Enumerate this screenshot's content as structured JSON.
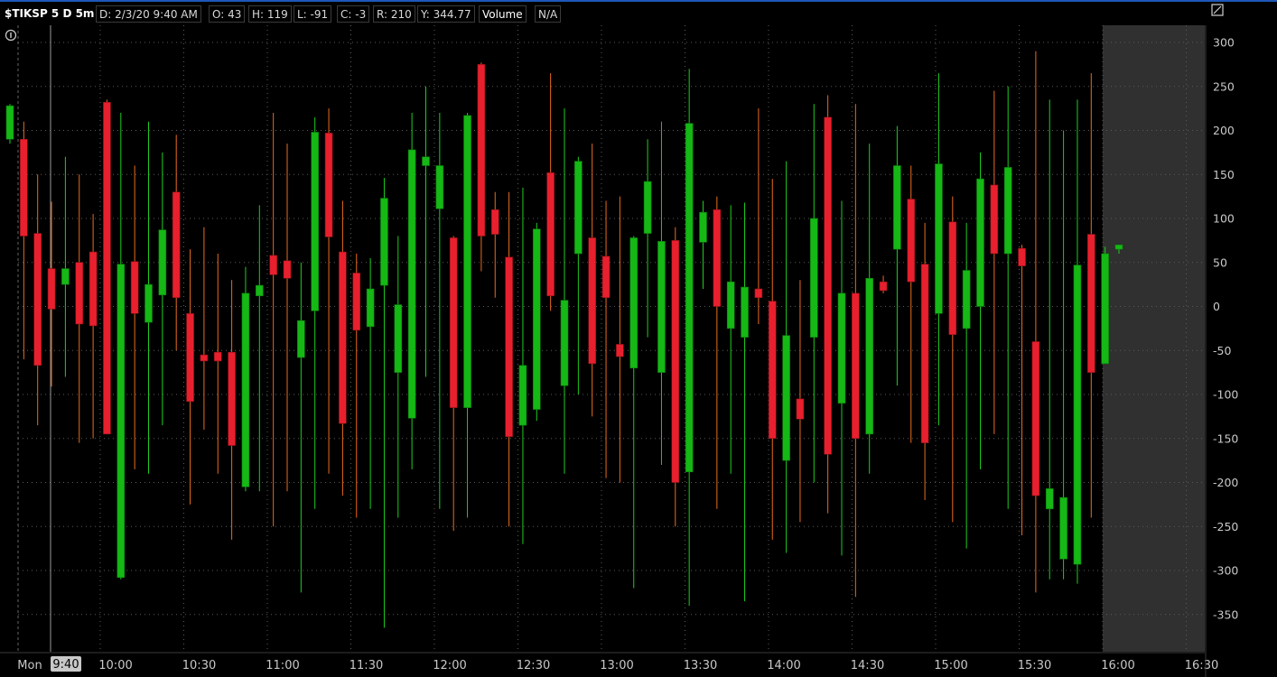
{
  "header": {
    "symbol": "$TIKSP 5 D 5m",
    "date": "D: 2/3/20 9:40 AM",
    "open": "O: 43",
    "high": "H: 119",
    "low": "L: -91",
    "close": "C: -3",
    "range": "R: 210",
    "y_value": "Y: 344.77",
    "volume_label": "Volume",
    "volume_value": "N/A"
  },
  "colors": {
    "up": "#15b815",
    "down": "#e8202e",
    "up_wick": "#1ecc1e",
    "down_wick": "#e86b1e",
    "grid": "#5a5a5a",
    "after_hours": "#303030"
  },
  "cursor_label": "9:40",
  "chart_data": {
    "type": "candlestick",
    "title": "$TIKSP 5 D 5m",
    "ylim": [
      -375,
      300
    ],
    "y_ticks": [
      300,
      250,
      200,
      150,
      100,
      50,
      0,
      -50,
      -100,
      -150,
      -200,
      -250,
      -300,
      -350
    ],
    "x_ticks": [
      "Mon",
      "10:00",
      "10:30",
      "11:00",
      "11:30",
      "12:00",
      "12:30",
      "13:00",
      "13:30",
      "14:00",
      "14:30",
      "15:00",
      "15:30",
      "16:00",
      "16:30"
    ],
    "cursor_time": "9:40",
    "grid": true,
    "after_hours_from": "16:00",
    "candles": [
      {
        "t": "9:30",
        "o": 190,
        "h": 230,
        "l": 185,
        "c": 228
      },
      {
        "t": "9:35",
        "o": 190,
        "h": 210,
        "l": -60,
        "c": 80
      },
      {
        "t": "9:40",
        "o": 83,
        "h": 150,
        "l": -135,
        "c": -67
      },
      {
        "t": "9:45",
        "o": 43,
        "h": 119,
        "l": -91,
        "c": -3
      },
      {
        "t": "9:50",
        "o": 25,
        "h": 170,
        "l": -80,
        "c": 43
      },
      {
        "t": "9:55",
        "o": 50,
        "h": 150,
        "l": -155,
        "c": -20
      },
      {
        "t": "10:00",
        "o": 62,
        "h": 105,
        "l": -150,
        "c": -22
      },
      {
        "t": "10:05",
        "o": 232,
        "h": 235,
        "l": -130,
        "c": -145
      },
      {
        "t": "10:10",
        "o": -308,
        "h": 220,
        "l": -310,
        "c": 48
      },
      {
        "t": "10:15",
        "o": 51,
        "h": 160,
        "l": -185,
        "c": -8
      },
      {
        "t": "10:20",
        "o": -18,
        "h": 210,
        "l": -190,
        "c": 25
      },
      {
        "t": "10:25",
        "o": 13,
        "h": 175,
        "l": -135,
        "c": 87
      },
      {
        "t": "10:30",
        "o": 130,
        "h": 195,
        "l": -50,
        "c": 10
      },
      {
        "t": "10:35",
        "o": -8,
        "h": 65,
        "l": -225,
        "c": -108
      },
      {
        "t": "10:40",
        "o": -55,
        "h": 90,
        "l": -140,
        "c": -62
      },
      {
        "t": "10:45",
        "o": -52,
        "h": 60,
        "l": -190,
        "c": -62
      },
      {
        "t": "10:50",
        "o": -52,
        "h": 30,
        "l": -265,
        "c": -158
      },
      {
        "t": "10:55",
        "o": -205,
        "h": 45,
        "l": -210,
        "c": 15
      },
      {
        "t": "11:00",
        "o": 12,
        "h": 115,
        "l": -210,
        "c": 24
      },
      {
        "t": "11:05",
        "o": 58,
        "h": 220,
        "l": -250,
        "c": 36
      },
      {
        "t": "11:10",
        "o": 52,
        "h": 185,
        "l": -210,
        "c": 32
      },
      {
        "t": "11:15",
        "o": -58,
        "h": 50,
        "l": -325,
        "c": -16
      },
      {
        "t": "11:20",
        "o": -5,
        "h": 215,
        "l": -230,
        "c": 198
      },
      {
        "t": "11:25",
        "o": 197,
        "h": 225,
        "l": -190,
        "c": 79
      },
      {
        "t": "11:30",
        "o": 62,
        "h": 120,
        "l": -215,
        "c": -133
      },
      {
        "t": "11:35",
        "o": 38,
        "h": 60,
        "l": -240,
        "c": -27
      },
      {
        "t": "11:40",
        "o": -23,
        "h": 55,
        "l": -230,
        "c": 20
      },
      {
        "t": "11:45",
        "o": 24,
        "h": 146,
        "l": -365,
        "c": 123
      },
      {
        "t": "11:50",
        "o": -75,
        "h": 80,
        "l": -240,
        "c": 2
      },
      {
        "t": "11:55",
        "o": -127,
        "h": 220,
        "l": -185,
        "c": 178
      },
      {
        "t": "12:00",
        "o": 160,
        "h": 250,
        "l": -80,
        "c": 170
      },
      {
        "t": "12:05",
        "o": 111,
        "h": 220,
        "l": -230,
        "c": 160
      },
      {
        "t": "12:10",
        "o": 78,
        "h": 80,
        "l": -255,
        "c": -115
      },
      {
        "t": "12:15",
        "o": -115,
        "h": 220,
        "l": -240,
        "c": 217
      },
      {
        "t": "12:20",
        "o": 275,
        "h": 277,
        "l": 40,
        "c": 80
      },
      {
        "t": "12:25",
        "o": 110,
        "h": 130,
        "l": 10,
        "c": 82
      },
      {
        "t": "12:30",
        "o": 56,
        "h": 130,
        "l": -250,
        "c": -148
      },
      {
        "t": "12:35",
        "o": -135,
        "h": 135,
        "l": -270,
        "c": -67
      },
      {
        "t": "12:40",
        "o": -117,
        "h": 95,
        "l": -130,
        "c": 88
      },
      {
        "t": "12:45",
        "o": 152,
        "h": 265,
        "l": -5,
        "c": 12
      },
      {
        "t": "12:50",
        "o": -90,
        "h": 225,
        "l": -190,
        "c": 7
      },
      {
        "t": "12:55",
        "o": 60,
        "h": 170,
        "l": -100,
        "c": 165
      },
      {
        "t": "13:00",
        "o": 78,
        "h": 185,
        "l": -125,
        "c": -65
      },
      {
        "t": "13:05",
        "o": 57,
        "h": 120,
        "l": -195,
        "c": 10
      },
      {
        "t": "13:10",
        "o": -43,
        "h": 125,
        "l": -200,
        "c": -57
      },
      {
        "t": "13:15",
        "o": -70,
        "h": 80,
        "l": -320,
        "c": 78
      },
      {
        "t": "13:20",
        "o": 83,
        "h": 190,
        "l": -35,
        "c": 142
      },
      {
        "t": "13:25",
        "o": -75,
        "h": 210,
        "l": -180,
        "c": 74
      },
      {
        "t": "13:30",
        "o": 75,
        "h": 90,
        "l": -250,
        "c": -200
      },
      {
        "t": "13:35",
        "o": -188,
        "h": 270,
        "l": -340,
        "c": 208
      },
      {
        "t": "13:40",
        "o": 73,
        "h": 120,
        "l": 20,
        "c": 107
      },
      {
        "t": "13:45",
        "o": 110,
        "h": 125,
        "l": -230,
        "c": 0
      },
      {
        "t": "13:50",
        "o": -25,
        "h": 115,
        "l": -190,
        "c": 28
      },
      {
        "t": "13:55",
        "o": -35,
        "h": 118,
        "l": -335,
        "c": 22
      },
      {
        "t": "14:00",
        "o": 20,
        "h": 225,
        "l": -20,
        "c": 10
      },
      {
        "t": "14:05",
        "o": 6,
        "h": 145,
        "l": -265,
        "c": -150
      },
      {
        "t": "14:10",
        "o": -175,
        "h": 165,
        "l": -280,
        "c": -33
      },
      {
        "t": "14:15",
        "o": -105,
        "h": 30,
        "l": -245,
        "c": -128
      },
      {
        "t": "14:20",
        "o": -35,
        "h": 230,
        "l": -200,
        "c": 100
      },
      {
        "t": "14:25",
        "o": 215,
        "h": 240,
        "l": -235,
        "c": -168
      },
      {
        "t": "14:30",
        "o": -110,
        "h": 120,
        "l": -283,
        "c": 15
      },
      {
        "t": "14:35",
        "o": 15,
        "h": 230,
        "l": -330,
        "c": -150
      },
      {
        "t": "14:40",
        "o": -145,
        "h": 185,
        "l": -190,
        "c": 32
      },
      {
        "t": "14:45",
        "o": 28,
        "h": 35,
        "l": 15,
        "c": 18
      },
      {
        "t": "14:50",
        "o": 65,
        "h": 205,
        "l": -90,
        "c": 160
      },
      {
        "t": "14:55",
        "o": 122,
        "h": 160,
        "l": -155,
        "c": 28
      },
      {
        "t": "15:00",
        "o": 48,
        "h": 95,
        "l": -220,
        "c": -155
      },
      {
        "t": "15:05",
        "o": -8,
        "h": 265,
        "l": -135,
        "c": 162
      },
      {
        "t": "15:10",
        "o": 96,
        "h": 125,
        "l": -245,
        "c": -32
      },
      {
        "t": "15:15",
        "o": -25,
        "h": 95,
        "l": -275,
        "c": 41
      },
      {
        "t": "15:20",
        "o": 0,
        "h": 175,
        "l": -185,
        "c": 145
      },
      {
        "t": "15:25",
        "o": 138,
        "h": 245,
        "l": -145,
        "c": 60
      },
      {
        "t": "15:30",
        "o": 60,
        "h": 250,
        "l": -230,
        "c": 158
      },
      {
        "t": "15:35",
        "o": 66,
        "h": 70,
        "l": -260,
        "c": 46
      },
      {
        "t": "15:40",
        "o": -40,
        "h": 290,
        "l": -325,
        "c": -215
      },
      {
        "t": "15:45",
        "o": -230,
        "h": 235,
        "l": -310,
        "c": -207
      },
      {
        "t": "15:50",
        "o": -287,
        "h": 200,
        "l": -310,
        "c": -217
      },
      {
        "t": "15:55",
        "o": -293,
        "h": 235,
        "l": -315,
        "c": 47
      },
      {
        "t": "15:55b",
        "o": 82,
        "h": 265,
        "l": -240,
        "c": -75
      },
      {
        "t": "16:00",
        "o": -65,
        "h": 68,
        "l": -65,
        "c": 60
      },
      {
        "t": "16:05",
        "o": 65,
        "h": 70,
        "l": 60,
        "c": 70
      }
    ]
  }
}
